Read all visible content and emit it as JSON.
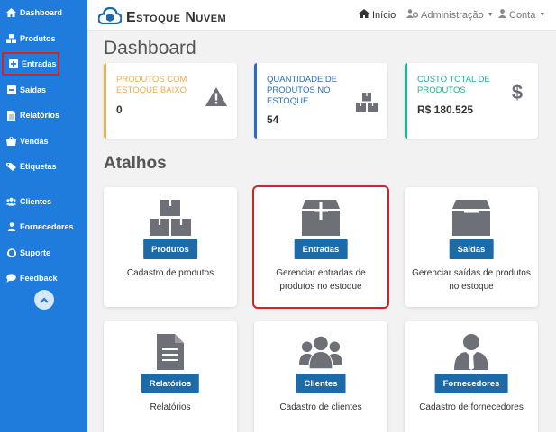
{
  "sidebar": {
    "items": [
      {
        "label": "Dashboard",
        "icon": "home-icon"
      },
      {
        "label": "Produtos",
        "icon": "boxes-icon"
      },
      {
        "label": "Entradas",
        "icon": "plus-square-icon"
      },
      {
        "label": "Saídas",
        "icon": "minus-square-icon"
      },
      {
        "label": "Relatórios",
        "icon": "file-icon"
      },
      {
        "label": "Vendas",
        "icon": "basket-icon"
      },
      {
        "label": "Etiquetas",
        "icon": "tag-icon"
      },
      {
        "label": "Clientes",
        "icon": "users-icon"
      },
      {
        "label": "Fornecedores",
        "icon": "user-tie-icon"
      },
      {
        "label": "Suporte",
        "icon": "support-icon"
      },
      {
        "label": "Feedback",
        "icon": "chat-icon"
      }
    ],
    "highlighted": "Entradas"
  },
  "header": {
    "brand": "Estoque Nuvem",
    "nav": {
      "home": "Início",
      "admin": "Administração",
      "account": "Conta"
    }
  },
  "main": {
    "title": "Dashboard",
    "stats": [
      {
        "label": "Produtos com estoque baixo",
        "value": "0",
        "color": "#f0ad4e",
        "icon": "warning-icon"
      },
      {
        "label": "Quantidade de produtos no estoque",
        "value": "54",
        "color": "#2a6ebb",
        "icon": "boxes-icon"
      },
      {
        "label": "Custo total de produtos",
        "value": "R$ 180.525",
        "color": "#1bb394",
        "icon": "dollar-icon"
      }
    ],
    "shortcuts_title": "Atalhos",
    "shortcuts": [
      {
        "button": "Produtos",
        "description": "Cadastro de produtos",
        "icon": "boxes-icon"
      },
      {
        "button": "Entradas",
        "description": "Gerenciar entradas de produtos no estoque",
        "icon": "box-plus-icon"
      },
      {
        "button": "Saídas",
        "description": "Gerenciar saídas de produtos no estoque",
        "icon": "box-minus-icon"
      },
      {
        "button": "Relatórios",
        "description": "Relatórios",
        "icon": "document-icon"
      },
      {
        "button": "Clientes",
        "description": "Cadastro de clientes",
        "icon": "users-icon"
      },
      {
        "button": "Fornecedores",
        "description": "Cadastro de fornecedores",
        "icon": "user-tie-icon"
      }
    ],
    "highlighted_shortcut": "Entradas"
  },
  "colors": {
    "sidebar_bg": "#1f7bdc",
    "button_bg": "#1c6aa8",
    "highlight": "#d2232a",
    "icon_gray": "#6e7077"
  }
}
